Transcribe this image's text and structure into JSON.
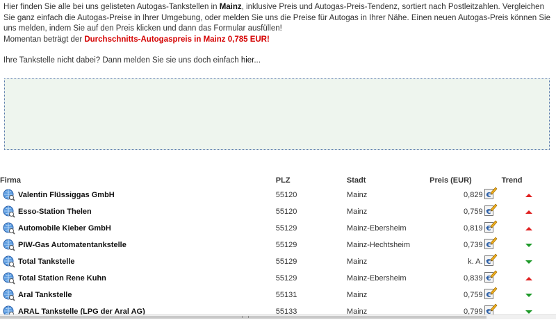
{
  "intro": {
    "p1_a": "Hier finden Sie alle bei uns gelisteten Autogas-Tankstellen in ",
    "p1_city": "Mainz",
    "p1_b": ", inklusive Preis und Autogas-Preis-Tendenz, sortiert nach Postleitzahlen. Vergleichen Sie ganz einfach die Autogas-Preise in Ihrer Umgebung, oder melden Sie uns die Preise für Autogas in Ihrer Nähe. Einen neuen Autogas-Preis können Sie uns melden, indem Sie auf den Preis klicken und dann das Formular ausfüllen!",
    "p2_a": "Momentan beträgt der ",
    "p2_highlight": "Durchschnitts-Autogaspreis in Mainz 0,785 EUR",
    "p2_b": "!",
    "p3_a": "Ihre Tankstelle nicht dabei? Dann melden Sie sie uns doch einfach ",
    "p3_link": "hier..."
  },
  "table": {
    "headers": {
      "firma": "Firma",
      "plz": "PLZ",
      "stadt": "Stadt",
      "preis": "Preis (EUR)",
      "trend": "Trend"
    },
    "rows": [
      {
        "firma": "Valentin Flüssiggas GmbH",
        "plz": "55120",
        "stadt": "Mainz",
        "preis": "0,829",
        "trend": "up"
      },
      {
        "firma": "Esso-Station Thelen",
        "plz": "55120",
        "stadt": "Mainz",
        "preis": "0,759",
        "trend": "up"
      },
      {
        "firma": "Automobile Kieber GmbH",
        "plz": "55129",
        "stadt": "Mainz-Ebersheim",
        "preis": "0,819",
        "trend": "up"
      },
      {
        "firma": "PIW-Gas Automatentankstelle",
        "plz": "55129",
        "stadt": "Mainz-Hechtsheim",
        "preis": "0,739",
        "trend": "down"
      },
      {
        "firma": "Total Tankstelle",
        "plz": "55129",
        "stadt": "Mainz",
        "preis": "k. A.",
        "trend": "down"
      },
      {
        "firma": "Total Station Rene Kuhn",
        "plz": "55129",
        "stadt": "Mainz-Ebersheim",
        "preis": "0,839",
        "trend": "up"
      },
      {
        "firma": "Aral Tankstelle",
        "plz": "55131",
        "stadt": "Mainz",
        "preis": "0,759",
        "trend": "down"
      },
      {
        "firma": "ARAL Tankstelle (LPG der Aral AG)",
        "plz": "55133",
        "stadt": "Mainz",
        "preis": "0,799",
        "trend": "down"
      }
    ]
  },
  "icons": {
    "station": "globe-search-icon",
    "price": "euro-report-icon",
    "trend_up": "trend-up-icon",
    "trend_down": "trend-down-icon"
  },
  "colors": {
    "highlight": "#d40000",
    "trend_up": "#e02020",
    "trend_down": "#1f9a2a",
    "ad_background": "#eef5ee"
  }
}
